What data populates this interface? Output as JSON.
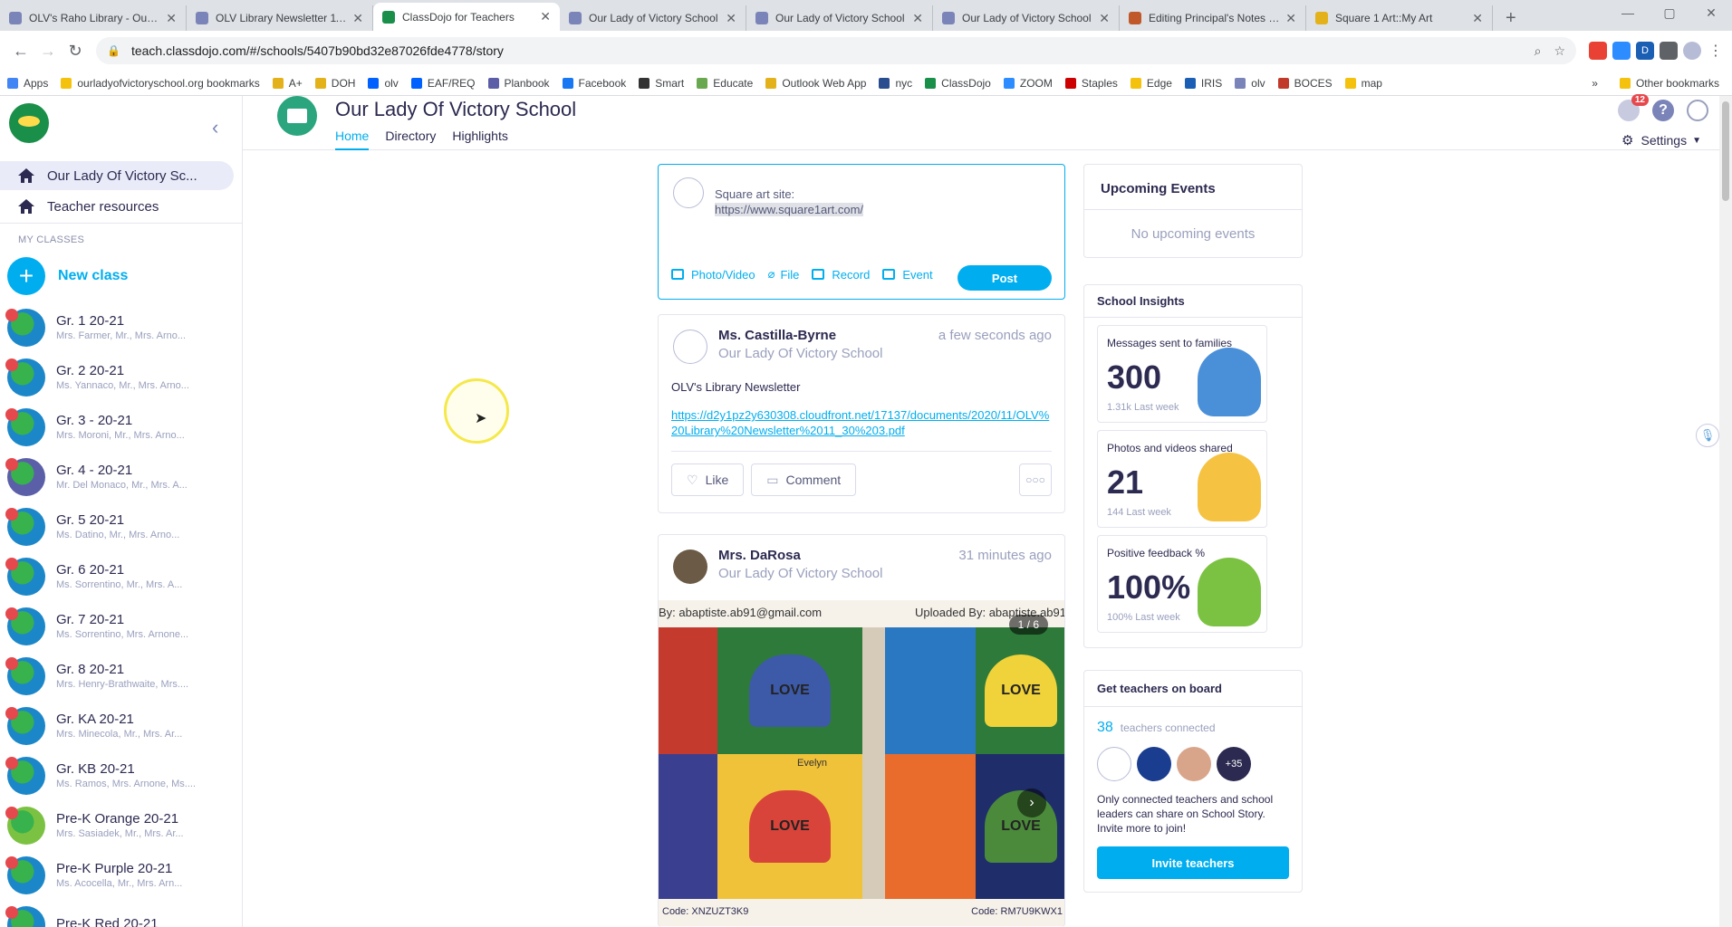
{
  "browser": {
    "tabs": [
      {
        "title": "OLV's Raho Library - Our La",
        "color": "#7a84b8"
      },
      {
        "title": "OLV Library Newsletter 11/3",
        "color": "#7a84b8"
      },
      {
        "title": "ClassDojo for Teachers",
        "color": "#1a8f4a",
        "active": true
      },
      {
        "title": "Our Lady of Victory School",
        "color": "#7a84b8"
      },
      {
        "title": "Our Lady of Victory School",
        "color": "#7a84b8"
      },
      {
        "title": "Our Lady of Victory School",
        "color": "#7a84b8"
      },
      {
        "title": "Editing Principal's Notes - S",
        "color": "#c0582a"
      },
      {
        "title": "Square 1 Art::My Art",
        "color": "#e3b21b"
      }
    ],
    "url": "teach.classdojo.com/#/schools/5407b90bd32e87026fde4778/story",
    "bookmarks": [
      {
        "label": "Apps",
        "color": "#4285f4"
      },
      {
        "label": "ourladyofvictoryschool.org bookmarks",
        "color": "#f4c20d"
      },
      {
        "label": "A+",
        "color": "#e3b21b"
      },
      {
        "label": "DOH",
        "color": "#e3b21b"
      },
      {
        "label": "olv",
        "color": "#0061fe"
      },
      {
        "label": "EAF/REQ",
        "color": "#0061fe"
      },
      {
        "label": "Planbook",
        "color": "#5b5ea6"
      },
      {
        "label": "Facebook",
        "color": "#1877f2"
      },
      {
        "label": "Smart",
        "color": "#333333"
      },
      {
        "label": "Educate",
        "color": "#6aa84f"
      },
      {
        "label": "Outlook Web App",
        "color": "#e3b21b"
      },
      {
        "label": "nyc",
        "color": "#2a4d8f"
      },
      {
        "label": "ClassDojo",
        "color": "#1a8f4a"
      },
      {
        "label": "ZOOM",
        "color": "#2d8cff"
      },
      {
        "label": "Staples",
        "color": "#cc0000"
      },
      {
        "label": "Edge",
        "color": "#f4c20d"
      },
      {
        "label": "IRIS",
        "color": "#1a5fb4"
      },
      {
        "label": "olv",
        "color": "#7a84b8"
      },
      {
        "label": "BOCES",
        "color": "#c0392b"
      },
      {
        "label": "map",
        "color": "#f4c20d"
      }
    ],
    "bookmarks_more": "»",
    "other_bookmarks": "Other bookmarks"
  },
  "sidebar": {
    "school": "Our Lady Of Victory Sc...",
    "resources": "Teacher resources",
    "my_classes": "MY CLASSES",
    "new_class": "New class",
    "classes": [
      {
        "name": "Gr. 1 20-21",
        "teachers": "Mrs. Farmer, Mr., Mrs. Arno...",
        "color": "#1b87c9"
      },
      {
        "name": "Gr. 2 20-21",
        "teachers": "Ms. Yannaco, Mr., Mrs. Arno...",
        "color": "#1b87c9"
      },
      {
        "name": "Gr. 3 - 20-21",
        "teachers": "Mrs. Moroni, Mr., Mrs. Arno...",
        "color": "#1b87c9"
      },
      {
        "name": "Gr. 4 - 20-21",
        "teachers": "Mr. Del Monaco, Mr., Mrs. A...",
        "color": "#5a5fa8"
      },
      {
        "name": "Gr. 5 20-21",
        "teachers": "Ms. Datino, Mr., Mrs. Arno...",
        "color": "#1b87c9"
      },
      {
        "name": "Gr. 6 20-21",
        "teachers": "Ms. Sorrentino, Mr., Mrs. A...",
        "color": "#1b87c9"
      },
      {
        "name": "Gr. 7 20-21",
        "teachers": "Ms. Sorrentino, Mrs. Arnone...",
        "color": "#1b87c9"
      },
      {
        "name": "Gr. 8 20-21",
        "teachers": "Mrs. Henry-Brathwaite, Mrs....",
        "color": "#1b87c9"
      },
      {
        "name": "Gr. KA 20-21",
        "teachers": "Mrs. Minecola, Mr., Mrs. Ar...",
        "color": "#1b87c9"
      },
      {
        "name": "Gr. KB 20-21",
        "teachers": "Ms. Ramos, Mrs. Arnone, Ms....",
        "color": "#1b87c9"
      },
      {
        "name": "Pre-K Orange 20-21",
        "teachers": "Mrs. Sasiadek, Mr., Mrs. Ar...",
        "color": "#7cc242"
      },
      {
        "name": "Pre-K Purple 20-21",
        "teachers": "Ms. Acocella, Mr., Mrs. Arn...",
        "color": "#1b87c9"
      },
      {
        "name": "Pre-K Red 20-21",
        "teachers": "",
        "color": "#1b87c9"
      }
    ]
  },
  "header": {
    "title": "Our Lady Of Victory School",
    "tabs": [
      "Home",
      "Directory",
      "Highlights"
    ],
    "notif_count": "12",
    "settings": "Settings"
  },
  "composer": {
    "line1": "Square art site:",
    "line2": "https://www.square1art.com/",
    "tools": [
      "Photo/Video",
      "File",
      "Record",
      "Event"
    ],
    "post": "Post"
  },
  "posts": [
    {
      "author": "Ms. Castilla-Byrne",
      "school": "Our Lady Of Victory  School",
      "time": "a few seconds ago",
      "body": "OLV's Library Newsletter",
      "link": "https://d2y1pz2y630308.cloudfront.net/17137/documents/2020/11/OLV%20Library%20Newsletter%2011_30%203.pdf",
      "like": "Like",
      "comment": "Comment"
    },
    {
      "author": "Mrs. DaRosa",
      "school": "Our Lady Of Victory  School",
      "time": "31 minutes ago",
      "photo_left_caption": "By: abaptiste.ab91@gmail.com",
      "photo_right_caption": "Uploaded By: abaptiste.ab91",
      "counter": "1 / 6",
      "heart_word": "LOVE",
      "signature": "Evelyn",
      "code_left": "Code: XNZUZT3K9",
      "code_right": "Code: RM7U9KWX1"
    }
  ],
  "events": {
    "title": "Upcoming Events",
    "empty": "No upcoming events"
  },
  "insights": {
    "title": "School Insights",
    "cards": [
      {
        "label": "Messages sent to families",
        "value": "300",
        "sub": "1.31k Last week",
        "color": "#4a90d9"
      },
      {
        "label": "Photos and videos shared",
        "value": "21",
        "sub": "144 Last week",
        "color": "#f5c242"
      },
      {
        "label": "Positive feedback %",
        "value": "100%",
        "sub": "100% Last week",
        "color": "#7cc242"
      }
    ]
  },
  "teachers": {
    "title": "Get teachers on board",
    "count": "38",
    "count_label": "teachers connected",
    "more": "+35",
    "text": "Only connected teachers and school leaders can share on School Story. Invite more to join!",
    "invite": "Invite teachers"
  }
}
